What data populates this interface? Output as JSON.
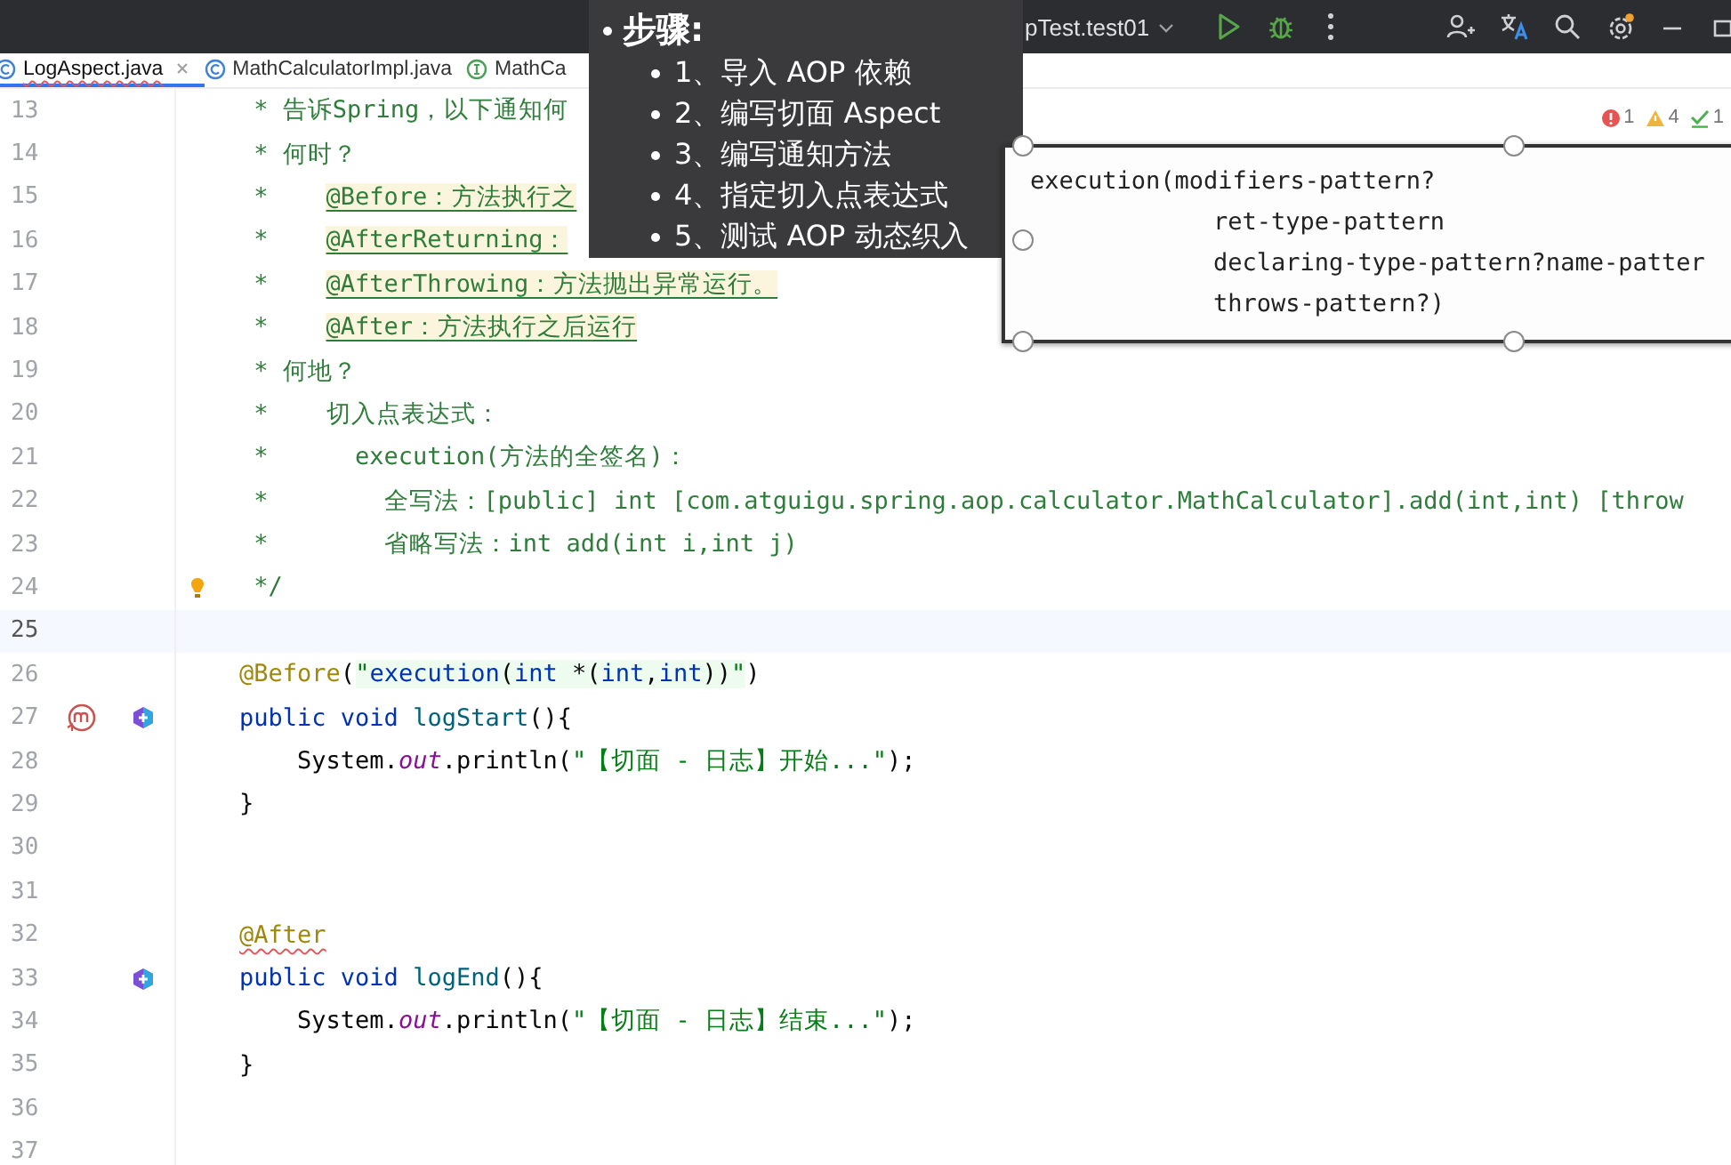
{
  "toolbar": {
    "run_config": "pTest.test01"
  },
  "tabs": [
    {
      "label": "LogAspect.java",
      "kind": "class",
      "selected": true,
      "error": true,
      "closable": true
    },
    {
      "label": "MathCalculatorImpl.java",
      "kind": "class",
      "selected": false,
      "error": false,
      "closable": false
    },
    {
      "label": "MathCa",
      "kind": "interface",
      "selected": false,
      "error": false,
      "closable": false
    }
  ],
  "problems": {
    "errors": "1",
    "warnings": "4",
    "passed": "1"
  },
  "editor": {
    "lines": [
      {
        "number": "13",
        "tokens": [
          {
            "t": "     * 告诉Spring，以下通知何",
            "kind": "comment"
          }
        ]
      },
      {
        "number": "14",
        "tokens": [
          {
            "t": "     * 何时？",
            "kind": "comment"
          }
        ]
      },
      {
        "number": "15",
        "tokens": [
          {
            "t": "     *    ",
            "kind": "comment"
          },
          {
            "t": "@Before：方法执行之",
            "kind": "doctag"
          }
        ]
      },
      {
        "number": "16",
        "tokens": [
          {
            "t": "     *    ",
            "kind": "comment"
          },
          {
            "t": "@AfterReturning：",
            "kind": "doctag"
          }
        ]
      },
      {
        "number": "17",
        "tokens": [
          {
            "t": "     *    ",
            "kind": "comment"
          },
          {
            "t": "@AfterThrowing：方法抛出异常运行。",
            "kind": "doctag"
          }
        ]
      },
      {
        "number": "18",
        "tokens": [
          {
            "t": "     *    ",
            "kind": "comment"
          },
          {
            "t": "@After：方法执行之后运行",
            "kind": "doctag"
          }
        ]
      },
      {
        "number": "19",
        "tokens": [
          {
            "t": "     * 何地？",
            "kind": "comment"
          }
        ]
      },
      {
        "number": "20",
        "tokens": [
          {
            "t": "     *    切入点表达式：",
            "kind": "comment"
          }
        ]
      },
      {
        "number": "21",
        "tokens": [
          {
            "t": "     *      execution(方法的全签名)：",
            "kind": "comment"
          }
        ]
      },
      {
        "number": "22",
        "tokens": [
          {
            "t": "     *        全写法：[public] int [com.atguigu.spring.aop.calculator.MathCalculator].add(int,int) [throw",
            "kind": "comment"
          }
        ]
      },
      {
        "number": "23",
        "tokens": [
          {
            "t": "     *        省略写法：int add(int i,int j)",
            "kind": "comment"
          }
        ]
      },
      {
        "number": "24",
        "bulb": true,
        "tokens": [
          {
            "t": "     */",
            "kind": "comment"
          }
        ]
      },
      {
        "number": "25",
        "current": true
      },
      {
        "number": "26",
        "tokens": [
          {
            "t": "    @Before",
            "kind": "annotation"
          },
          {
            "t": "(",
            "kind": "plain"
          },
          {
            "t": "\"",
            "kind": "string",
            "injected": true
          },
          {
            "t": "execution",
            "kind": "injkeyword",
            "injected": true
          },
          {
            "t": "(",
            "kind": "plain",
            "injected": true
          },
          {
            "t": "int",
            "kind": "injkeyword",
            "injected": true
          },
          {
            "t": " *(",
            "kind": "plain",
            "injected": true
          },
          {
            "t": "int",
            "kind": "injkeyword",
            "injected": true
          },
          {
            "t": ",",
            "kind": "plain",
            "injected": true
          },
          {
            "t": "int",
            "kind": "injkeyword",
            "injected": true
          },
          {
            "t": "))",
            "kind": "plain",
            "injected": true
          },
          {
            "t": "\"",
            "kind": "string",
            "injected": true
          },
          {
            "t": ")",
            "kind": "plain"
          }
        ]
      },
      {
        "number": "27",
        "gutter": [
          {
            "kind": "m-circle"
          },
          {
            "kind": "hexagon"
          }
        ],
        "tokens": [
          {
            "t": "    public void ",
            "kind": "keyword"
          },
          {
            "t": "logStart",
            "kind": "method"
          },
          {
            "t": "(){",
            "kind": "plain"
          }
        ]
      },
      {
        "number": "28",
        "tokens": [
          {
            "t": "        System.",
            "kind": "plain"
          },
          {
            "t": "out",
            "kind": "static"
          },
          {
            "t": ".println(",
            "kind": "plain"
          },
          {
            "t": "\"【切面 - 日志】开始...\"",
            "kind": "string"
          },
          {
            "t": ");",
            "kind": "plain"
          }
        ]
      },
      {
        "number": "29",
        "tokens": [
          {
            "t": "    }",
            "kind": "plain"
          }
        ]
      },
      {
        "number": "30"
      },
      {
        "number": "31"
      },
      {
        "number": "32",
        "tokens": [
          {
            "t": "    @After",
            "kind": "annotation",
            "error": true
          }
        ]
      },
      {
        "number": "33",
        "gutter": [
          {
            "kind": "hexagon"
          }
        ],
        "tokens": [
          {
            "t": "    public void ",
            "kind": "keyword"
          },
          {
            "t": "logEnd",
            "kind": "method"
          },
          {
            "t": "(){",
            "kind": "plain"
          }
        ]
      },
      {
        "number": "34",
        "tokens": [
          {
            "t": "        System.",
            "kind": "plain"
          },
          {
            "t": "out",
            "kind": "static"
          },
          {
            "t": ".println(",
            "kind": "plain"
          },
          {
            "t": "\"【切面 - 日志】结束...\"",
            "kind": "string"
          },
          {
            "t": ");",
            "kind": "plain"
          }
        ]
      },
      {
        "number": "35",
        "tokens": [
          {
            "t": "    }",
            "kind": "plain"
          }
        ]
      },
      {
        "number": "36"
      },
      {
        "number": "37"
      }
    ]
  },
  "steps_panel": {
    "title": "步骤:",
    "items": [
      "1、导入 AOP 依赖",
      "2、编写切面 Aspect",
      "3、编写通知方法",
      "4、指定切入点表达式",
      "5、测试 AOP 动态织入"
    ]
  },
  "syntax_card": {
    "lines": [
      {
        "text": "execution(modifiers-pattern?",
        "kind": "first"
      },
      {
        "text": "ret-type-pattern",
        "kind": "continuation"
      },
      {
        "text": "declaring-type-pattern?name-patter",
        "kind": "continuation"
      },
      {
        "text": "throws-pattern?)",
        "kind": "continuation"
      }
    ]
  }
}
